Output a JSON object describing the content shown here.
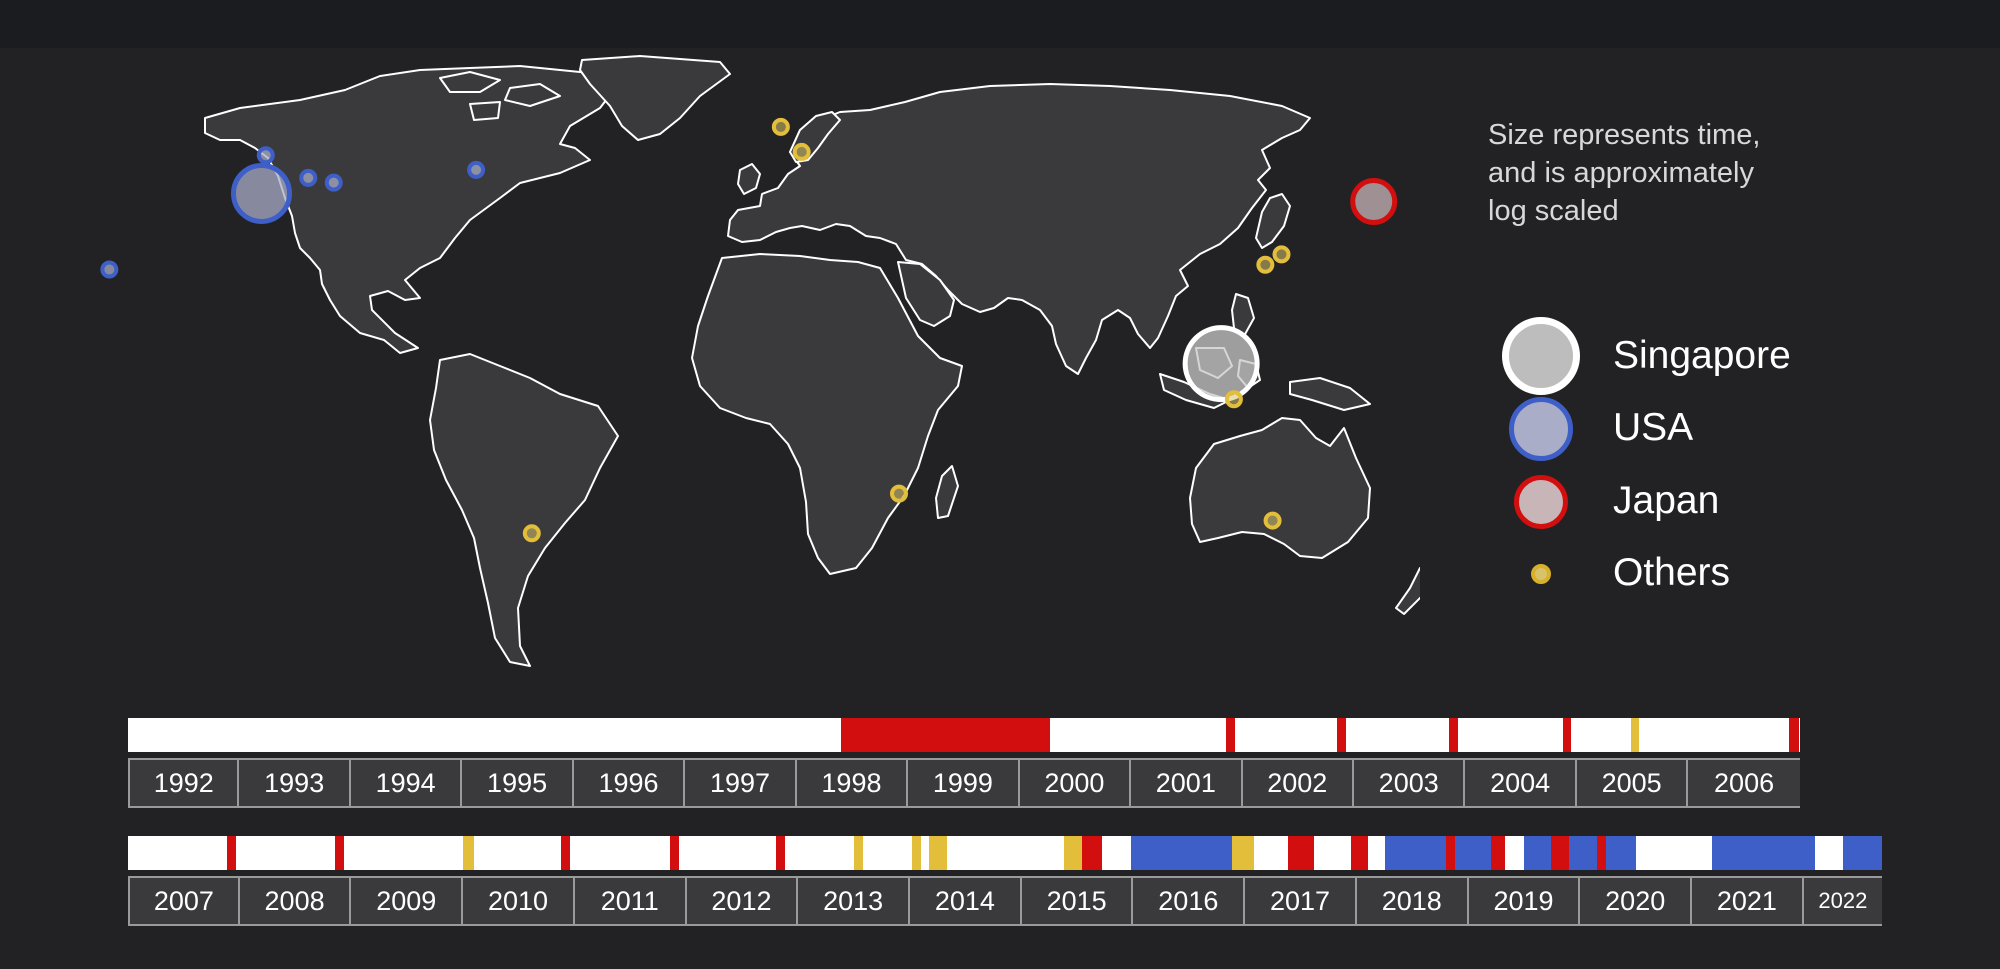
{
  "annotation": {
    "lines": [
      "Size represents time,",
      "and is approximately",
      "log scaled"
    ]
  },
  "legend": [
    {
      "label": "Singapore",
      "fill": "#bdbdbd",
      "stroke": "#ffffff",
      "size_rank": 4
    },
    {
      "label": "USA",
      "fill": "#a9adc7",
      "stroke": "#3e5fc8",
      "size_rank": 3
    },
    {
      "label": "Japan",
      "fill": "#c8b5b8",
      "stroke": "#d20e0e",
      "size_rank": 2
    },
    {
      "label": "Others",
      "fill": "#d7c36a",
      "stroke": "#d8b02a",
      "size_rank": 1
    }
  ],
  "colors": {
    "background": "#222224",
    "land": "#3a3a3c",
    "coast": "#ffffff",
    "singapore": "#ffffff",
    "usa": "#3e5fc8",
    "japan": "#d20e0e",
    "others": "#e2be3a"
  },
  "locations": [
    {
      "category": "Singapore",
      "lon": 103.8,
      "lat": 1.35,
      "time_rank": 5
    },
    {
      "category": "USA",
      "lon": -122.0,
      "lat": 37.4,
      "time_rank": 4
    },
    {
      "category": "USA",
      "lon": -121.0,
      "lat": 45.5,
      "time_rank": 1
    },
    {
      "category": "USA",
      "lon": -111.0,
      "lat": 40.7,
      "time_rank": 1
    },
    {
      "category": "USA",
      "lon": -105.0,
      "lat": 39.7,
      "time_rank": 1
    },
    {
      "category": "USA",
      "lon": -71.5,
      "lat": 42.4,
      "time_rank": 1
    },
    {
      "category": "USA",
      "lon": -157.8,
      "lat": 21.3,
      "time_rank": 1
    },
    {
      "category": "Japan",
      "lon": 139.7,
      "lat": 35.7,
      "time_rank": 3
    },
    {
      "category": "Others",
      "lon": 0.2,
      "lat": 51.5,
      "time_rank": 1
    },
    {
      "category": "Others",
      "lon": 5.1,
      "lat": 46.2,
      "time_rank": 1
    },
    {
      "category": "Others",
      "lon": 118.0,
      "lat": 24.5,
      "time_rank": 1
    },
    {
      "category": "Others",
      "lon": 114.2,
      "lat": 22.3,
      "time_rank": 1
    },
    {
      "category": "Others",
      "lon": 106.8,
      "lat": -6.2,
      "time_rank": 1
    },
    {
      "category": "Others",
      "lon": 115.9,
      "lat": -31.9,
      "time_rank": 1
    },
    {
      "category": "Others",
      "lon": 28.0,
      "lat": -26.2,
      "time_rank": 1
    },
    {
      "category": "Others",
      "lon": -58.4,
      "lat": -34.6,
      "time_rank": 1
    }
  ],
  "timelines": [
    {
      "years": [
        "1992",
        "1993",
        "1994",
        "1995",
        "1996",
        "1997",
        "1998",
        "1999",
        "2000",
        "2001",
        "2002",
        "2003",
        "2004",
        "2005",
        "2006"
      ],
      "start_year": 1992,
      "end_year": 2007,
      "segments": [
        {
          "category": "Japan",
          "from": 1998.4,
          "to": 2000.27
        },
        {
          "category": "Japan",
          "from": 2001.85,
          "to": 2001.93
        },
        {
          "category": "Japan",
          "from": 2002.85,
          "to": 2002.93
        },
        {
          "category": "Japan",
          "from": 2003.85,
          "to": 2003.93
        },
        {
          "category": "Japan",
          "from": 2004.87,
          "to": 2004.95
        },
        {
          "category": "Others",
          "from": 2005.48,
          "to": 2005.56
        },
        {
          "category": "Japan",
          "from": 2006.9,
          "to": 2006.99
        }
      ]
    },
    {
      "years": [
        "2007",
        "2008",
        "2009",
        "2010",
        "2011",
        "2012",
        "2013",
        "2014",
        "2015",
        "2016",
        "2017",
        "2018",
        "2019",
        "2020",
        "2021",
        "2022"
      ],
      "start_year": 2007,
      "end_year": 2022.7,
      "segments": [
        {
          "category": "Japan",
          "from": 2007.89,
          "to": 2007.97
        },
        {
          "category": "Japan",
          "from": 2008.85,
          "to": 2008.93
        },
        {
          "category": "Others",
          "from": 2010.0,
          "to": 2010.1
        },
        {
          "category": "Japan",
          "from": 2010.88,
          "to": 2010.96
        },
        {
          "category": "Japan",
          "from": 2011.85,
          "to": 2011.93
        },
        {
          "category": "Japan",
          "from": 2012.8,
          "to": 2012.88
        },
        {
          "category": "Others",
          "from": 2013.5,
          "to": 2013.58
        },
        {
          "category": "Others",
          "from": 2014.02,
          "to": 2014.1
        },
        {
          "category": "Others",
          "from": 2014.17,
          "to": 2014.33
        },
        {
          "category": "Others",
          "from": 2015.38,
          "to": 2015.54
        },
        {
          "category": "Japan",
          "from": 2015.54,
          "to": 2015.72
        },
        {
          "category": "USA",
          "from": 2015.98,
          "to": 2016.88
        },
        {
          "category": "Others",
          "from": 2016.88,
          "to": 2017.08
        },
        {
          "category": "Japan",
          "from": 2017.38,
          "to": 2017.62
        },
        {
          "category": "Japan",
          "from": 2017.95,
          "to": 2018.1
        },
        {
          "category": "USA",
          "from": 2018.25,
          "to": 2018.8
        },
        {
          "category": "Japan",
          "from": 2018.8,
          "to": 2018.88
        },
        {
          "category": "USA",
          "from": 2018.88,
          "to": 2019.2
        },
        {
          "category": "Japan",
          "from": 2019.2,
          "to": 2019.33
        },
        {
          "category": "USA",
          "from": 2019.5,
          "to": 2019.74
        },
        {
          "category": "Japan",
          "from": 2019.74,
          "to": 2019.9
        },
        {
          "category": "USA",
          "from": 2019.9,
          "to": 2020.15
        },
        {
          "category": "Japan",
          "from": 2020.15,
          "to": 2020.23
        },
        {
          "category": "USA",
          "from": 2020.23,
          "to": 2020.5
        },
        {
          "category": "USA",
          "from": 2021.18,
          "to": 2022.1
        },
        {
          "category": "USA",
          "from": 2022.35,
          "to": 2022.7
        }
      ]
    }
  ]
}
